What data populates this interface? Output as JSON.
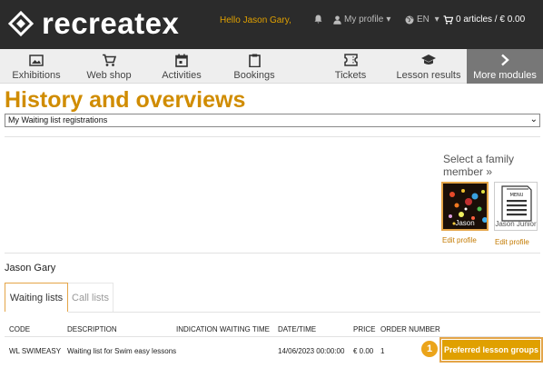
{
  "header": {
    "logo_text": "recreatex",
    "greeting": "Hello Jason Gary,",
    "my_profile": "My profile",
    "language": "EN",
    "cart": "0 articles / € 0.00"
  },
  "nav": {
    "items": [
      {
        "label": "Exhibitions",
        "icon": "image-icon"
      },
      {
        "label": "Web shop",
        "icon": "cart-icon"
      },
      {
        "label": "Activities",
        "icon": "calendar-icon"
      },
      {
        "label": "Bookings",
        "icon": "clipboard-icon"
      },
      {
        "label": "Tickets",
        "icon": "ticket-icon"
      },
      {
        "label": "Lesson results",
        "icon": "graduation-cap-icon"
      },
      {
        "label": "More modules",
        "icon": "chevron-right-icon"
      }
    ]
  },
  "page": {
    "title": "History and overviews",
    "selected_overview": "My Waiting list registrations"
  },
  "family": {
    "label": "Select a family member »",
    "members": [
      {
        "name": "Jason",
        "edit": "Edit profile"
      },
      {
        "name": "Jason Junior",
        "edit": "Edit profile"
      }
    ]
  },
  "member_name": "Jason Gary",
  "tabs": [
    "Waiting lists",
    "Call lists"
  ],
  "table": {
    "headers": [
      "CODE",
      "DESCRIPTION",
      "INDICATION WAITING TIME",
      "DATE/TIME",
      "PRICE",
      "ORDER NUMBER"
    ],
    "rows": [
      {
        "code": "WL SWIMEASY",
        "description": "Waiting list for Swim easy lessons",
        "waiting_time": "",
        "datetime": "14/06/2023 00:00:00",
        "price": "€ 0.00",
        "order_number": "1",
        "action": "Preferred lesson groups"
      }
    ]
  },
  "step_badge": "1",
  "colors": {
    "accent": "#e0a000",
    "title": "#d08c00",
    "header_bg": "#2b2b2b",
    "nav_bg": "#eeeeee"
  }
}
